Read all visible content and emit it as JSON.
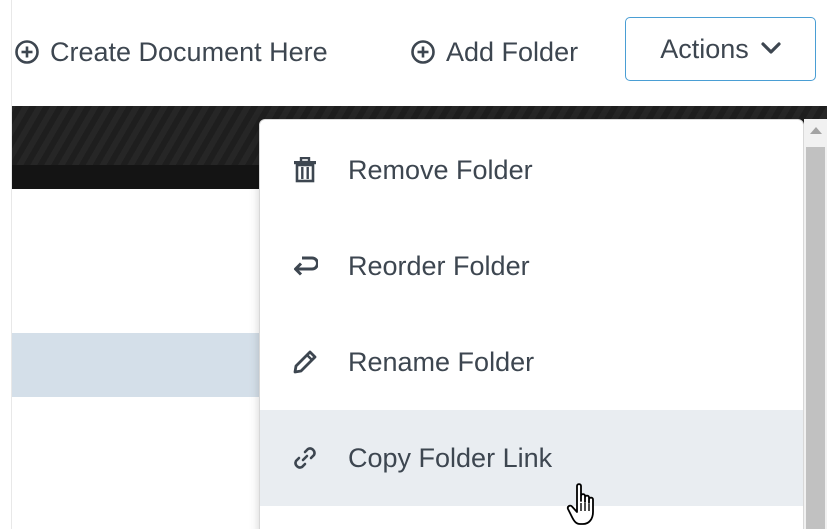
{
  "toolbar": {
    "create_label": "Create Document Here",
    "add_folder_label": "Add Folder",
    "actions_label": "Actions"
  },
  "menu": {
    "items": [
      {
        "label": "Remove Folder",
        "icon": "trash-icon"
      },
      {
        "label": "Reorder Folder",
        "icon": "return-arrow-icon"
      },
      {
        "label": "Rename Folder",
        "icon": "pencil-icon"
      },
      {
        "label": "Copy Folder Link",
        "icon": "link-icon"
      }
    ],
    "hovered_index": 3
  },
  "colors": {
    "text": "#3d4650",
    "accent_border": "#4a9ed4",
    "hover_bg": "#e9edf1",
    "selected_row_bg": "#d4dfe9"
  }
}
